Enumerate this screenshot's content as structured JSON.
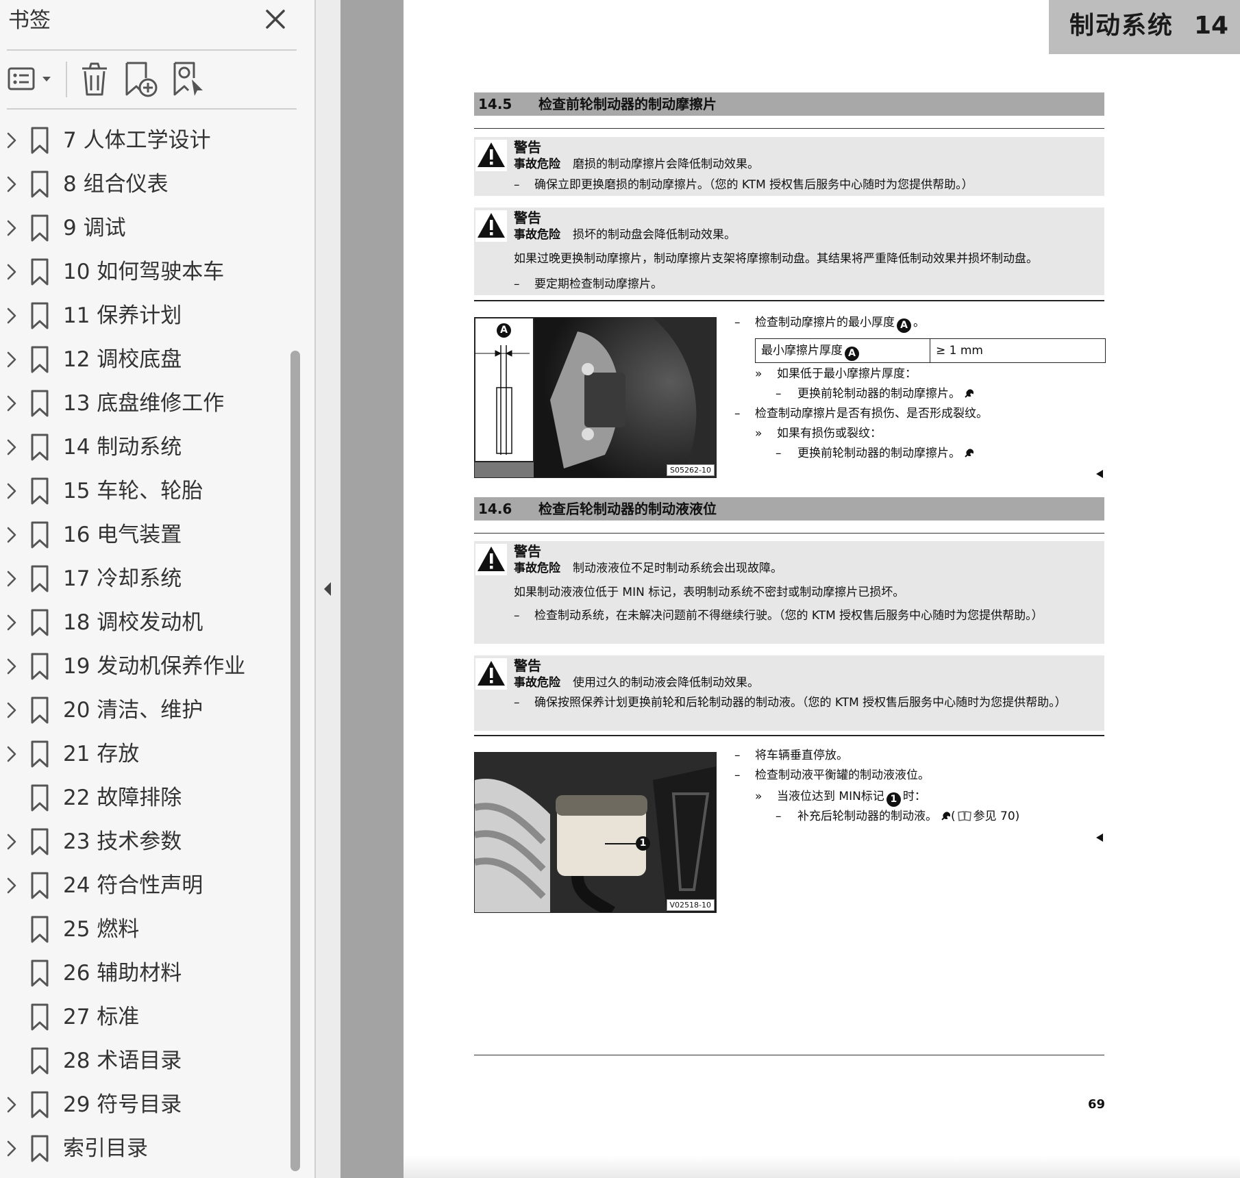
{
  "sidebar": {
    "title": "书签",
    "close_icon": "close-icon",
    "toolbar": {
      "icons": [
        "bookmark-list-options-icon",
        "delete-bookmark-icon",
        "add-bookmark-icon",
        "find-bookmark-icon"
      ]
    },
    "bookmarks": [
      {
        "label": "7 人体工学设计",
        "expandable": true
      },
      {
        "label": "8 组合仪表",
        "expandable": true
      },
      {
        "label": "9 调试",
        "expandable": true
      },
      {
        "label": "10 如何驾驶本车",
        "expandable": true
      },
      {
        "label": "11 保养计划",
        "expandable": true
      },
      {
        "label": "12 调校底盘",
        "expandable": true
      },
      {
        "label": "13 底盘维修工作",
        "expandable": true
      },
      {
        "label": "14 制动系统",
        "expandable": true
      },
      {
        "label": "15 车轮、轮胎",
        "expandable": true
      },
      {
        "label": "16 电气装置",
        "expandable": true
      },
      {
        "label": "17 冷却系统",
        "expandable": true
      },
      {
        "label": "18 调校发动机",
        "expandable": true
      },
      {
        "label": "19 发动机保养作业",
        "expandable": true
      },
      {
        "label": "20 清洁、维护",
        "expandable": true
      },
      {
        "label": "21 存放",
        "expandable": true
      },
      {
        "label": "22 故障排除",
        "expandable": false
      },
      {
        "label": "23 技术参数",
        "expandable": true
      },
      {
        "label": "24 符合性声明",
        "expandable": true
      },
      {
        "label": "25 燃料",
        "expandable": false
      },
      {
        "label": "26 辅助材料",
        "expandable": false
      },
      {
        "label": "27 标准",
        "expandable": false
      },
      {
        "label": "28 术语目录",
        "expandable": false
      },
      {
        "label": "29 符号目录",
        "expandable": true
      },
      {
        "label": "索引目录",
        "expandable": true
      }
    ]
  },
  "page": {
    "chapter_title": "制动系统",
    "chapter_number": "14",
    "page_number": "69",
    "section_1": {
      "number": "14.5",
      "title": "检查前轮制动器的制动摩擦片",
      "warning_1": {
        "label": "警告",
        "hazard_label": "事故危险",
        "hazard_text": "磨损的制动摩擦片会降低制动效果。",
        "dash": "确保立即更换磨损的制动摩擦片。（您的 KTM 授权售后服务中心随时为您提供帮助。）"
      },
      "warning_2": {
        "label": "警告",
        "hazard_label": "事故危险",
        "hazard_text": "损坏的制动盘会降低制动效果。",
        "line": "如果过晚更换制动摩擦片，制动摩擦片支架将摩擦制动盘。其结果将严重降低制动效果并损坏制动盘。",
        "dash": "要定期检查制动摩擦片。"
      },
      "photo_code": "S05262-10",
      "diagram_badge": "A",
      "steps": {
        "s1": "检查制动摩擦片的最小厚度",
        "s1_badge": "A",
        "s1_end": "。",
        "table_label": "最小摩擦片厚度",
        "table_badge": "A",
        "table_value": "≥ 1 mm",
        "s2": "如果低于最小摩擦片厚度：",
        "s3": "更换前轮制动器的制动摩擦片。",
        "s4": "检查制动摩擦片是否有损伤、是否形成裂纹。",
        "s5": "如果有损伤或裂纹：",
        "s6": "更换前轮制动器的制动摩擦片。"
      }
    },
    "section_2": {
      "number": "14.6",
      "title": "检查后轮制动器的制动液液位",
      "warning_1": {
        "label": "警告",
        "hazard_label": "事故危险",
        "hazard_text": "制动液液位不足时制动系统会出现故障。",
        "line": "如果制动液液位低于 MIN 标记，表明制动系统不密封或制动摩擦片已损坏。",
        "dash": "检查制动系统，在未解决问题前不得继续行驶。（您的 KTM 授权售后服务中心随时为您提供帮助。）"
      },
      "warning_2": {
        "label": "警告",
        "hazard_label": "事故危险",
        "hazard_text": "使用过久的制动液会降低制动效果。",
        "dash": "确保按照保养计划更换前轮和后轮制动器的制动液。（您的 KTM 授权售后服务中心随时为您提供帮助。）"
      },
      "photo_code": "V02518-10",
      "photo_badge": "1",
      "steps": {
        "s1": "将车辆垂直停放。",
        "s2": "检查制动液平衡罐的制动液液位。",
        "s3_a": "当液位达到 MIN标记",
        "s3_badge": "1",
        "s3_b": "时：",
        "s4": "补充后轮制动器的制动液。",
        "s4_ref": "参见 70)"
      }
    }
  },
  "markers": {
    "dash": "–",
    "chevron": "»"
  },
  "colors": {
    "sidebar_bg": "#f6f6f6",
    "gutter": "#a3a3a3",
    "section_header": "#a8a8a8",
    "warning_bg": "#e7e7e7",
    "chapter_tab": "#bdbdbd"
  }
}
